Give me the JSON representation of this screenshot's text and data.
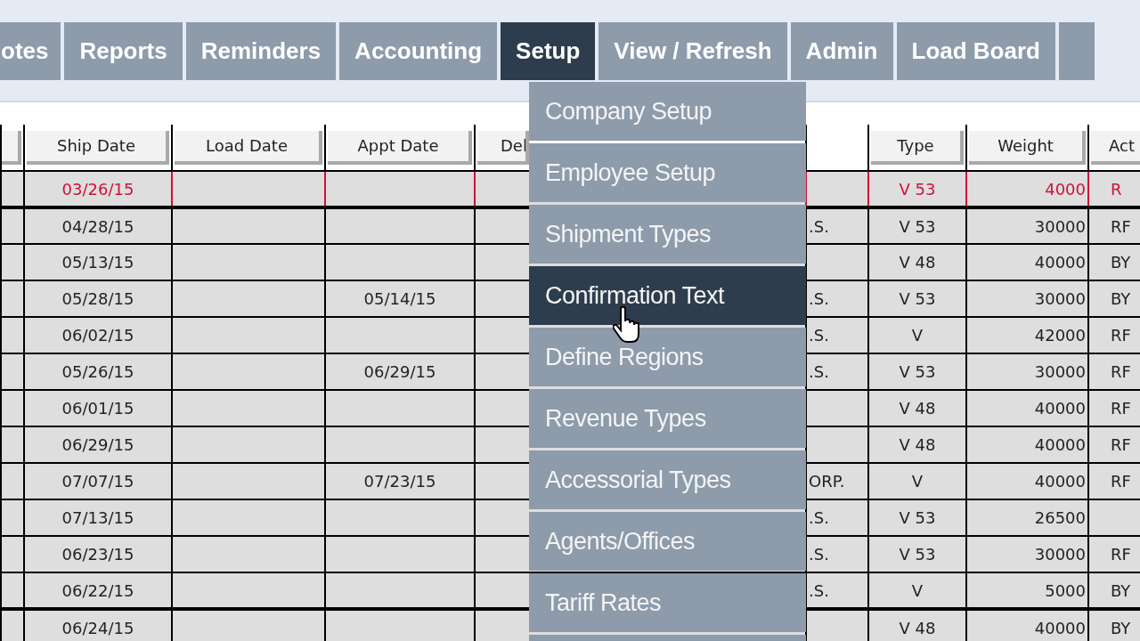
{
  "nav_tabs": [
    {
      "label": "otes",
      "selected": false
    },
    {
      "label": "Reports",
      "selected": false
    },
    {
      "label": "Reminders",
      "selected": false
    },
    {
      "label": "Accounting",
      "selected": false
    },
    {
      "label": "Setup",
      "selected": true
    },
    {
      "label": "View / Refresh",
      "selected": false
    },
    {
      "label": "Admin",
      "selected": false
    },
    {
      "label": "Load Board",
      "selected": false
    }
  ],
  "table": {
    "columns": [
      {
        "kind": "stub"
      },
      {
        "kind": "header",
        "label": "Ship Date"
      },
      {
        "kind": "header",
        "label": "Load Date"
      },
      {
        "kind": "header",
        "label": "Appt Date"
      },
      {
        "kind": "cut",
        "label": "Del"
      },
      {
        "kind": "blank"
      },
      {
        "kind": "header",
        "label": "Type"
      },
      {
        "kind": "number",
        "label": "Weight"
      },
      {
        "kind": "edge",
        "label": "Act"
      }
    ],
    "rows": [
      {
        "highlighted": true,
        "group_start": false,
        "cells": {
          "ship_date": "03/26/15",
          "type": "V 53",
          "weight": "4000",
          "act": "R"
        }
      },
      {
        "highlighted": false,
        "group_start": true,
        "cells": {
          "ship_date": "04/28/15",
          "column_6": ".S.",
          "type": "V 53",
          "weight": "30000",
          "act": "RF"
        }
      },
      {
        "highlighted": false,
        "group_start": false,
        "cells": {
          "ship_date": "05/13/15",
          "type": "V 48",
          "weight": "40000",
          "act": "BY"
        }
      },
      {
        "highlighted": false,
        "group_start": false,
        "cells": {
          "ship_date": "05/28/15",
          "appt_date": "05/14/15",
          "column_6": ".S.",
          "type": "V 53",
          "weight": "30000",
          "act": "BY"
        }
      },
      {
        "highlighted": false,
        "group_start": false,
        "cells": {
          "ship_date": "06/02/15",
          "column_6": ".S.",
          "type": "V",
          "weight": "42000",
          "act": "RF"
        }
      },
      {
        "highlighted": false,
        "group_start": false,
        "cells": {
          "ship_date": "05/26/15",
          "appt_date": "06/29/15",
          "column_6": ".S.",
          "type": "V 53",
          "weight": "30000",
          "act": "RF"
        }
      },
      {
        "highlighted": false,
        "group_start": false,
        "cells": {
          "ship_date": "06/01/15",
          "type": "V 48",
          "weight": "40000",
          "act": "RF"
        }
      },
      {
        "highlighted": false,
        "group_start": false,
        "cells": {
          "ship_date": "06/29/15",
          "type": "V 48",
          "weight": "40000",
          "act": "RF"
        }
      },
      {
        "highlighted": false,
        "group_start": false,
        "cells": {
          "ship_date": "07/07/15",
          "appt_date": "07/23/15",
          "column_6": "ORP.",
          "type": "V",
          "weight": "40000",
          "act": "RF"
        }
      },
      {
        "highlighted": false,
        "group_start": false,
        "cells": {
          "ship_date": "07/13/15",
          "column_6": ".S.",
          "type": "V 53",
          "weight": "26500"
        }
      },
      {
        "highlighted": false,
        "group_start": false,
        "cells": {
          "ship_date": "06/23/15",
          "column_6": ".S.",
          "type": "V 53",
          "weight": "30000",
          "act": "RF"
        }
      },
      {
        "highlighted": false,
        "group_start": false,
        "cells": {
          "ship_date": "06/22/15",
          "column_6": ".S.",
          "type": "V",
          "weight": "5000",
          "act": "BY"
        }
      },
      {
        "highlighted": false,
        "group_start": true,
        "cells": {
          "ship_date": "06/24/15",
          "type": "V 48",
          "weight": "40000",
          "act": "BY"
        }
      }
    ]
  },
  "setup_menu": {
    "items": [
      {
        "label": "Company Setup",
        "selected": false
      },
      {
        "label": "Employee Setup",
        "selected": false
      },
      {
        "label": "Shipment Types",
        "selected": false
      },
      {
        "label": "Confirmation Text",
        "selected": true
      },
      {
        "label": "Define Regions",
        "selected": false
      },
      {
        "label": "Revenue Types",
        "selected": false
      },
      {
        "label": "Accessorial Types",
        "selected": false
      },
      {
        "label": "Agents/Offices",
        "selected": false
      },
      {
        "label": "Tariff Rates",
        "selected": false
      }
    ]
  }
}
